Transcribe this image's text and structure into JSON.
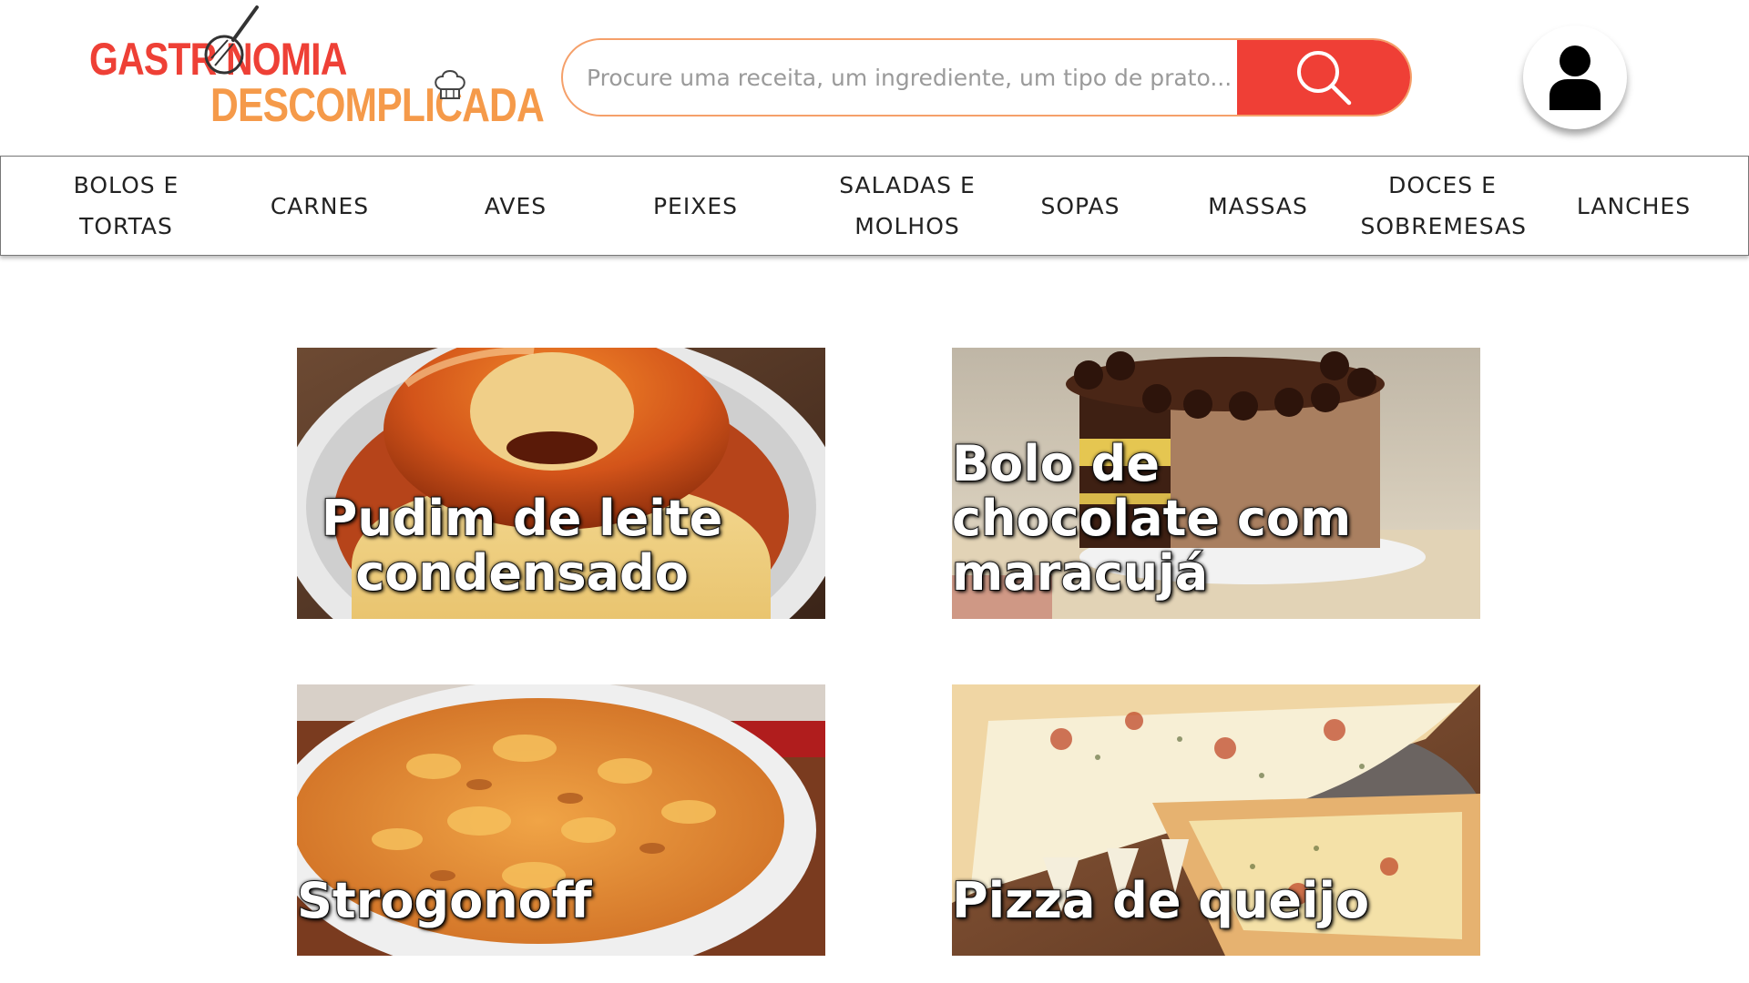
{
  "logo": {
    "line1": "GASTR NOMIA",
    "line2": "DESCOMPLICADA"
  },
  "search": {
    "placeholder": "Procure uma receita, um ingrediente, um tipo de prato...",
    "icon": "search-icon"
  },
  "user": {
    "icon": "user-icon"
  },
  "nav": {
    "items": [
      {
        "label": "BOLOS E TORTAS"
      },
      {
        "label": "CARNES"
      },
      {
        "label": "AVES"
      },
      {
        "label": "PEIXES"
      },
      {
        "label": "SALADAS E MOLHOS"
      },
      {
        "label": "SOPAS"
      },
      {
        "label": "MASSAS"
      },
      {
        "label": "DOCES E SOBREMESAS"
      },
      {
        "label": "LANCHES"
      }
    ]
  },
  "recipes": [
    {
      "title": "Pudim de leite condensado"
    },
    {
      "title": "Bolo de chocolate com maracujá"
    },
    {
      "title": "Strogonoff"
    },
    {
      "title": "Pizza de queijo"
    }
  ],
  "colors": {
    "brand_red": "#ee4036",
    "brand_orange": "#f59a4a",
    "search_border": "#f5a06a"
  }
}
